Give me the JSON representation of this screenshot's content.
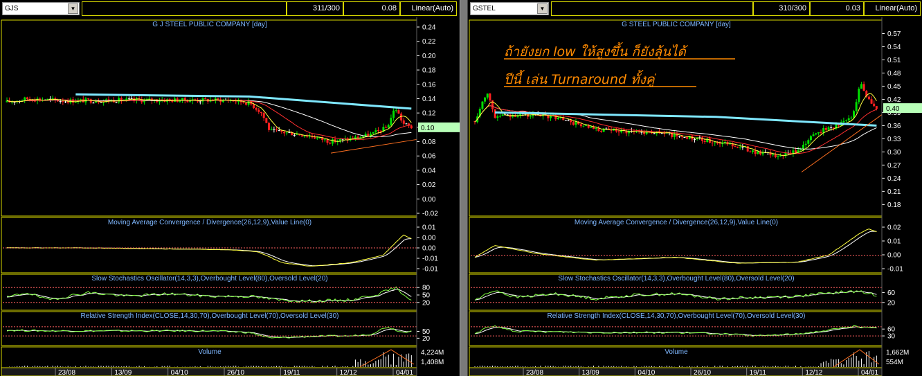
{
  "left": {
    "symbol": "GJS",
    "counter": "311/300",
    "value": "0.08",
    "scale_mode": "Linear(Auto)",
    "title": "G J STEEL PUBLIC COMPANY [day]",
    "price_badge": "0.10",
    "macd_title": "Moving Average Convergence / Divergence(26,12,9),Value Line(0)",
    "stoch_title": "Slow Stochastics Oscillator(14,3,3),Overbought Level(80),Oversold Level(20)",
    "rsi_title": "Relative Strength Index(CLOSE,14,30,70),Overbought Level(70),Oversold Level(30)",
    "volume_title": "Volume"
  },
  "right": {
    "symbol": "GSTEL",
    "counter": "310/300",
    "value": "0.03",
    "scale_mode": "Linear(Auto)",
    "title": "G STEEL PUBLIC COMPANY [day]",
    "price_badge": "0.40",
    "annotation_line1": "ถ้ายังยก low ให้สูงขึ้น ก็ยังลุ้นได้",
    "annotation_line2": "ปีนี้ เล่น Turnaround ทั้งคู่",
    "macd_title": "Moving Average Convergence / Divergence(26,12,9),Value Line(0)",
    "stoch_title": "Slow Stochastics Oscillator(14,3,3),Overbought Level(80),Oversold Level(20)",
    "rsi_title": "Relative Strength Index(CLOSE,14,30,70),Overbought Level(70),Oversold Level(30)",
    "volume_title": "Volume"
  },
  "colors": {
    "up_candle": "#00e000",
    "down_candle": "#ff2020",
    "doji": "#ffffff",
    "ma_cyan": "#7fe8ff",
    "ma_white": "#ffffff",
    "ma_red": "#ff3030",
    "ma_yellow": "#ffff40",
    "signal_green": "#80ff40",
    "trendline": "#ff7020",
    "level_line": "#ff6060",
    "panel_border": "#d8d800",
    "price_badge_bg": "#b8ffb8"
  },
  "chart_data": [
    {
      "type": "candlestick",
      "id": "gjs",
      "title": "G J STEEL PUBLIC COMPANY [day]",
      "x_ticks": [
        "23/08",
        "13/09",
        "04/10",
        "26/10",
        "19/11",
        "12/12",
        "04/01"
      ],
      "price_ticks": [
        "0.24",
        "0.22",
        "0.20",
        "0.18",
        "0.16",
        "0.14",
        "0.12",
        "0.10",
        "0.08",
        "0.06",
        "0.04",
        "0.02",
        "0.00",
        "-0.02"
      ],
      "ylim": [
        -0.02,
        0.24
      ],
      "last_price": 0.1,
      "macd_ticks": [
        "0.01",
        "0.00",
        "0.00",
        "-0.01",
        "-0.01"
      ],
      "macd_ylim": [
        -0.012,
        0.012
      ],
      "stoch_ticks": [
        "80",
        "50",
        "20"
      ],
      "rsi_ticks": [
        "50",
        "20"
      ],
      "volume_ticks": [
        "4,224M",
        "1,408M"
      ],
      "levels": {
        "stoch_overbought": 80,
        "stoch_oversold": 20,
        "rsi_overbought": 70,
        "rsi_oversold": 30
      },
      "price_anchors": [
        [
          0,
          0.135
        ],
        [
          0.05,
          0.14
        ],
        [
          0.15,
          0.137
        ],
        [
          0.3,
          0.138
        ],
        [
          0.45,
          0.138
        ],
        [
          0.55,
          0.138
        ],
        [
          0.6,
          0.134
        ],
        [
          0.63,
          0.12
        ],
        [
          0.65,
          0.095
        ],
        [
          0.7,
          0.092
        ],
        [
          0.75,
          0.088
        ],
        [
          0.8,
          0.08
        ],
        [
          0.85,
          0.084
        ],
        [
          0.9,
          0.09
        ],
        [
          0.94,
          0.1
        ],
        [
          0.96,
          0.128
        ],
        [
          0.98,
          0.105
        ],
        [
          1,
          0.1
        ]
      ],
      "ma_cyan": [
        [
          0.17,
          0.146
        ],
        [
          0.6,
          0.143
        ],
        [
          1,
          0.126
        ]
      ],
      "macd_anchors": [
        [
          0,
          0.0
        ],
        [
          0.2,
          0.0
        ],
        [
          0.55,
          -0.001
        ],
        [
          0.62,
          -0.002
        ],
        [
          0.68,
          -0.008
        ],
        [
          0.75,
          -0.01
        ],
        [
          0.85,
          -0.008
        ],
        [
          0.93,
          -0.004
        ],
        [
          0.98,
          0.007
        ],
        [
          1,
          0.005
        ]
      ],
      "stoch_anchors": [
        [
          0,
          40
        ],
        [
          0.05,
          60
        ],
        [
          0.1,
          30
        ],
        [
          0.2,
          60
        ],
        [
          0.3,
          45
        ],
        [
          0.4,
          55
        ],
        [
          0.5,
          45
        ],
        [
          0.6,
          45
        ],
        [
          0.67,
          30
        ],
        [
          0.75,
          25
        ],
        [
          0.85,
          30
        ],
        [
          0.92,
          55
        ],
        [
          0.96,
          80
        ],
        [
          1,
          30
        ]
      ],
      "rsi_anchors": [
        [
          0,
          55
        ],
        [
          0.1,
          52
        ],
        [
          0.3,
          52
        ],
        [
          0.5,
          52
        ],
        [
          0.6,
          45
        ],
        [
          0.65,
          20
        ],
        [
          0.75,
          28
        ],
        [
          0.85,
          30
        ],
        [
          0.9,
          38
        ],
        [
          0.94,
          70
        ],
        [
          0.98,
          45
        ],
        [
          1,
          55
        ]
      ]
    },
    {
      "type": "candlestick",
      "id": "gstel",
      "title": "G STEEL PUBLIC COMPANY [day]",
      "x_ticks": [
        "23/08",
        "13/09",
        "04/10",
        "26/10",
        "19/11",
        "12/12",
        "04/01"
      ],
      "price_ticks": [
        "0.57",
        "0.54",
        "0.51",
        "0.48",
        "0.45",
        "0.42",
        "0.39",
        "0.36",
        "0.33",
        "0.30",
        "0.27",
        "0.24",
        "0.21",
        "0.18"
      ],
      "ylim": [
        0.16,
        0.585
      ],
      "last_price": 0.4,
      "macd_ticks": [
        "0.02",
        "0.01",
        "0.00",
        "-0.01"
      ],
      "macd_ylim": [
        -0.015,
        0.03
      ],
      "stoch_ticks": [
        "60",
        "20"
      ],
      "rsi_ticks": [
        "60",
        "30"
      ],
      "volume_ticks": [
        "1,662M",
        "554M"
      ],
      "levels": {
        "stoch_overbought": 80,
        "stoch_oversold": 20,
        "rsi_overbought": 70,
        "rsi_oversold": 30
      },
      "price_anchors": [
        [
          0,
          0.37
        ],
        [
          0.03,
          0.44
        ],
        [
          0.05,
          0.38
        ],
        [
          0.1,
          0.385
        ],
        [
          0.2,
          0.38
        ],
        [
          0.3,
          0.35
        ],
        [
          0.45,
          0.345
        ],
        [
          0.55,
          0.33
        ],
        [
          0.65,
          0.315
        ],
        [
          0.7,
          0.3
        ],
        [
          0.75,
          0.29
        ],
        [
          0.8,
          0.3
        ],
        [
          0.85,
          0.345
        ],
        [
          0.9,
          0.36
        ],
        [
          0.94,
          0.38
        ],
        [
          0.96,
          0.46
        ],
        [
          0.98,
          0.42
        ],
        [
          1,
          0.4
        ]
      ],
      "ma_cyan": [
        [
          0.05,
          0.39
        ],
        [
          0.6,
          0.38
        ],
        [
          1,
          0.36
        ]
      ],
      "macd_anchors": [
        [
          0,
          -0.002
        ],
        [
          0.05,
          0.01
        ],
        [
          0.15,
          0.002
        ],
        [
          0.3,
          -0.005
        ],
        [
          0.5,
          -0.002
        ],
        [
          0.65,
          -0.008
        ],
        [
          0.8,
          -0.007
        ],
        [
          0.88,
          0.0
        ],
        [
          0.95,
          0.02
        ],
        [
          0.98,
          0.027
        ],
        [
          1,
          0.024
        ]
      ],
      "stoch_anchors": [
        [
          0,
          30
        ],
        [
          0.05,
          70
        ],
        [
          0.1,
          40
        ],
        [
          0.2,
          55
        ],
        [
          0.3,
          35
        ],
        [
          0.4,
          50
        ],
        [
          0.5,
          55
        ],
        [
          0.6,
          35
        ],
        [
          0.7,
          40
        ],
        [
          0.8,
          45
        ],
        [
          0.9,
          60
        ],
        [
          0.95,
          65
        ],
        [
          1,
          50
        ]
      ],
      "rsi_anchors": [
        [
          0,
          40
        ],
        [
          0.04,
          75
        ],
        [
          0.1,
          50
        ],
        [
          0.2,
          48
        ],
        [
          0.3,
          45
        ],
        [
          0.5,
          45
        ],
        [
          0.6,
          40
        ],
        [
          0.7,
          30
        ],
        [
          0.8,
          38
        ],
        [
          0.88,
          55
        ],
        [
          0.94,
          72
        ],
        [
          1,
          62
        ]
      ]
    }
  ]
}
